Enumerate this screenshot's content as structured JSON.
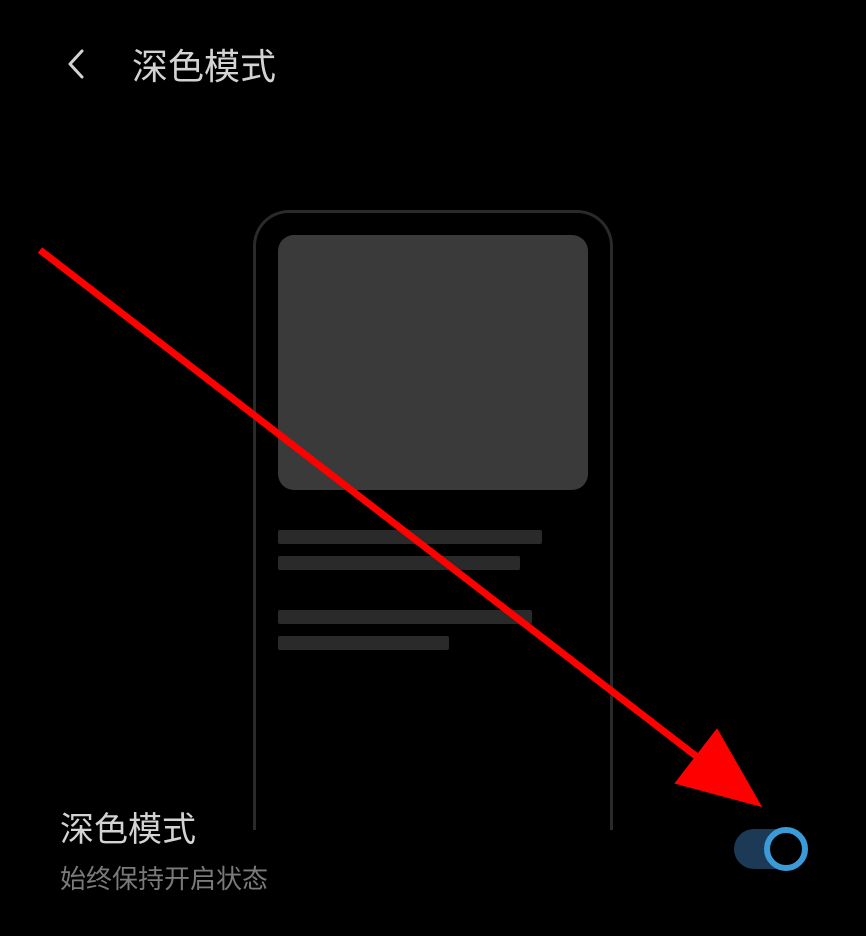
{
  "header": {
    "title": "深色模式"
  },
  "setting": {
    "title": "深色模式",
    "subtitle": "始终保持开启状态",
    "enabled": true
  }
}
